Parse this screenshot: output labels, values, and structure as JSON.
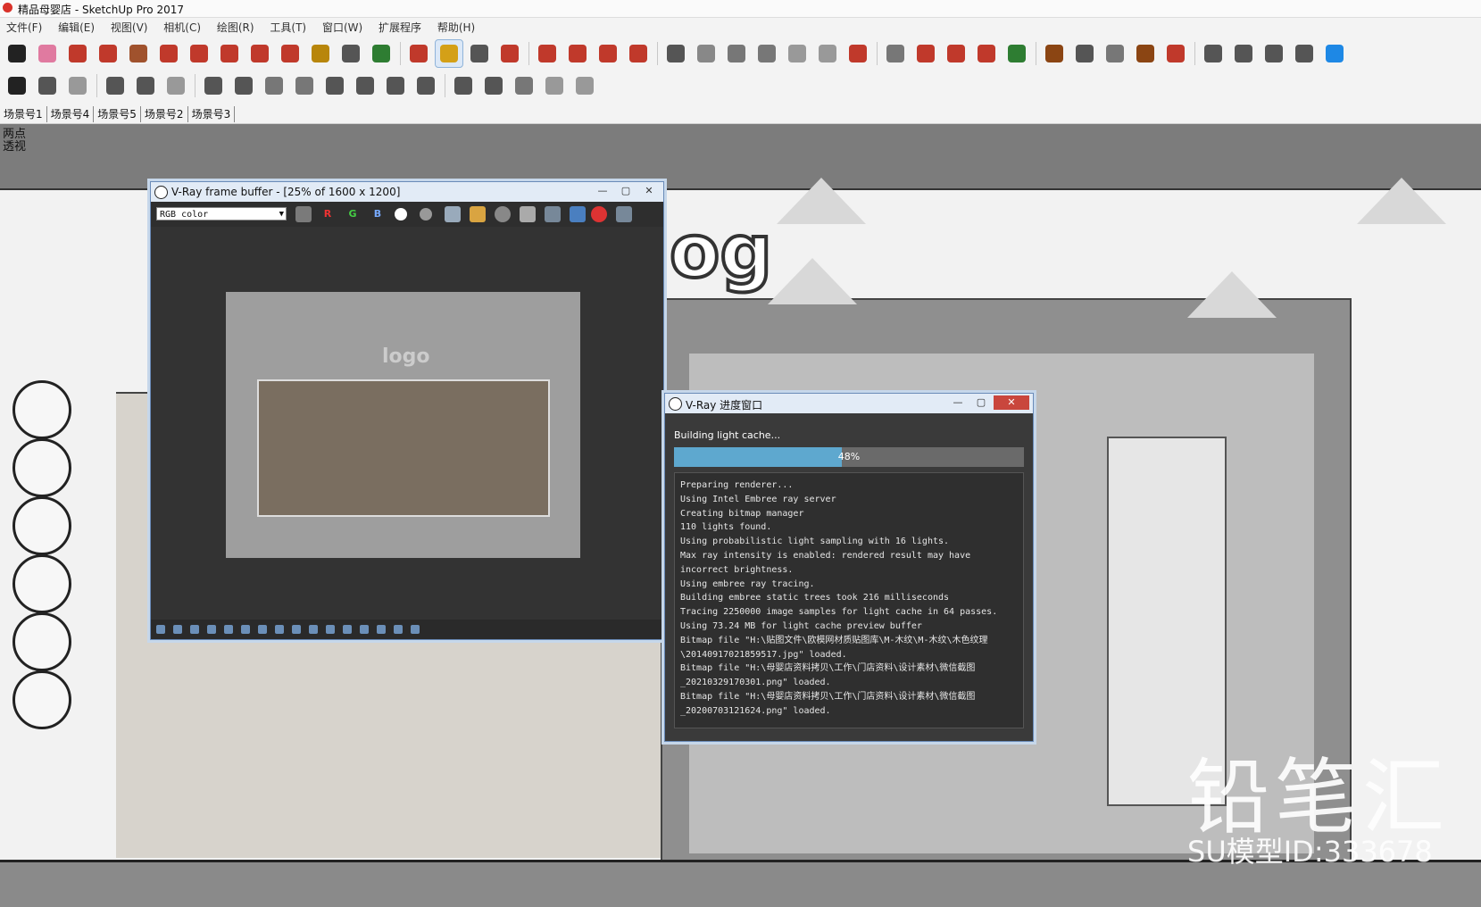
{
  "window": {
    "title": "精品母婴店 - SketchUp Pro 2017"
  },
  "menu": [
    "文件(F)",
    "编辑(E)",
    "视图(V)",
    "相机(C)",
    "绘图(R)",
    "工具(T)",
    "窗口(W)",
    "扩展程序",
    "帮助(H)"
  ],
  "toolbar": {
    "row1": [
      {
        "name": "select-tool-icon",
        "color": "#222"
      },
      {
        "name": "eraser-tool-icon",
        "color": "#e07aa0"
      },
      {
        "name": "pencil-tool-icon",
        "color": "#c0392b"
      },
      {
        "name": "arc-tool-icon",
        "color": "#c0392b"
      },
      {
        "name": "rectangle-tool-icon",
        "color": "#a0522d"
      },
      {
        "name": "push-pull-tool-icon",
        "color": "#c0392b"
      },
      {
        "name": "follow-me-tool-icon",
        "color": "#c0392b"
      },
      {
        "name": "move-tool-icon",
        "color": "#c0392b"
      },
      {
        "name": "rotate-tool-icon",
        "color": "#c0392b"
      },
      {
        "name": "scale-tool-icon",
        "color": "#c0392b"
      },
      {
        "name": "tape-measure-tool-icon",
        "color": "#b8860b"
      },
      {
        "name": "text-tool-icon",
        "color": "#555"
      },
      {
        "name": "paint-bucket-tool-icon",
        "color": "#2e7d32"
      },
      {
        "name": "orbit-tool-icon",
        "color": "#c0392b"
      },
      {
        "name": "pan-tool-icon",
        "color": "#d4a017"
      },
      {
        "name": "zoom-tool-icon",
        "color": "#555"
      },
      {
        "name": "zoom-extents-tool-icon",
        "color": "#c0392b"
      },
      {
        "name": "vray-render-icon",
        "color": "#c0392b"
      },
      {
        "name": "vray-interactive-icon",
        "color": "#c0392b"
      },
      {
        "name": "vray-cloud-icon",
        "color": "#c0392b"
      },
      {
        "name": "vray-gem-icon",
        "color": "#c0392b"
      },
      {
        "name": "vray-light-icon",
        "color": "#555"
      },
      {
        "name": "vray-sphere-light-icon",
        "color": "#888"
      },
      {
        "name": "vray-spot-light-icon",
        "color": "#777"
      },
      {
        "name": "vray-ies-light-icon",
        "color": "#777"
      },
      {
        "name": "vray-mesh-light-icon",
        "color": "#999"
      },
      {
        "name": "vray-omni-light-icon",
        "color": "#999"
      },
      {
        "name": "vray-remove-icon",
        "color": "#c0392b"
      },
      {
        "name": "plugin-tool-1-icon",
        "color": "#777"
      },
      {
        "name": "plugin-tool-2-icon",
        "color": "#c0392b"
      },
      {
        "name": "plugin-tool-3-icon",
        "color": "#c0392b"
      },
      {
        "name": "plugin-tool-4-icon",
        "color": "#c0392b"
      },
      {
        "name": "plugin-tool-5-icon",
        "color": "#2e7d32"
      },
      {
        "name": "plugin-tool-6-icon",
        "color": "#8b4513"
      },
      {
        "name": "plugin-tool-7-icon",
        "color": "#555"
      },
      {
        "name": "plugin-tool-8-icon",
        "color": "#777"
      },
      {
        "name": "plugin-tool-9-icon",
        "color": "#8b4513"
      },
      {
        "name": "plugin-tool-10-icon",
        "color": "#c0392b"
      },
      {
        "name": "component-tool-icon",
        "color": "#555"
      },
      {
        "name": "checkbox-tool-icon",
        "color": "#555"
      },
      {
        "name": "cloud-upload-icon",
        "color": "#555"
      },
      {
        "name": "add-link-icon",
        "color": "#555"
      },
      {
        "name": "sketchup-logo-icon",
        "color": "#1e88e5"
      }
    ],
    "row2": [
      {
        "name": "xray-style-icon",
        "color": "#222"
      },
      {
        "name": "back-edges-style-icon",
        "color": "#555"
      },
      {
        "name": "wireframe-style-icon",
        "color": "#999"
      },
      {
        "name": "hidden-line-style-icon",
        "color": "#555"
      },
      {
        "name": "shaded-style-icon",
        "color": "#555"
      },
      {
        "name": "shaded-textures-style-icon",
        "color": "#999"
      },
      {
        "name": "camera-view-icon",
        "color": "#555"
      },
      {
        "name": "sphere-view-icon",
        "color": "#555"
      },
      {
        "name": "cone-view-icon",
        "color": "#777"
      },
      {
        "name": "cylinder-view-icon",
        "color": "#777"
      },
      {
        "name": "sun-icon",
        "color": "#555"
      },
      {
        "name": "dome-icon",
        "color": "#555"
      },
      {
        "name": "globe-icon",
        "color": "#555"
      },
      {
        "name": "settings-sun-icon",
        "color": "#555"
      },
      {
        "name": "section-plane-icon",
        "color": "#555"
      },
      {
        "name": "section-cut-icon",
        "color": "#555"
      },
      {
        "name": "section-fill-icon",
        "color": "#777"
      },
      {
        "name": "grass-icon",
        "color": "#999"
      },
      {
        "name": "material-icon",
        "color": "#999"
      }
    ]
  },
  "scene_tabs": [
    "场景号1",
    "场景号4",
    "场景号5",
    "场景号2",
    "场景号3"
  ],
  "viewport": {
    "label_line1": "两点",
    "label_line2": "透视",
    "logo_text": "og",
    "watermark_big": "铅笔汇",
    "watermark_id": "SU模型ID:333678"
  },
  "vfb": {
    "title": "V-Ray frame buffer - [25% of 1600 x 1200]",
    "channel": "RGB color",
    "r_label": "R",
    "g_label": "G",
    "b_label": "B",
    "render_logo": "logo"
  },
  "vray_progress": {
    "title": "V-Ray 进度窗口",
    "status": "Building light cache...",
    "progress_percent": 48,
    "progress_text": "48%",
    "log": [
      "Preparing renderer...",
      "Using Intel Embree ray server",
      "Creating bitmap manager",
      "110 lights found.",
      "Using probabilistic light sampling with 16 lights.",
      "Max ray intensity is enabled: rendered result may have",
      "incorrect brightness.",
      "Using embree ray tracing.",
      "Building embree static trees took 216 milliseconds",
      "Tracing 2250000 image samples for light cache in 64 passes.",
      "Using 73.24 MB for light cache preview buffer",
      "Bitmap file \"H:\\贴图文件\\欧模网材质贴图库\\M-木纹\\M-木纹\\木色纹理",
      "\\20140917021859517.jpg\" loaded.",
      "Bitmap file \"H:\\母婴店资料拷贝\\工作\\门店资料\\设计素材\\微信截图",
      "_20210329170301.png\" loaded.",
      "Bitmap file \"H:\\母婴店资料拷贝\\工作\\门店资料\\设计素材\\微信截图",
      "_20200703121624.png\" loaded."
    ]
  },
  "window_buttons": {
    "minimize": "—",
    "maximize": "▢",
    "close": "✕"
  }
}
